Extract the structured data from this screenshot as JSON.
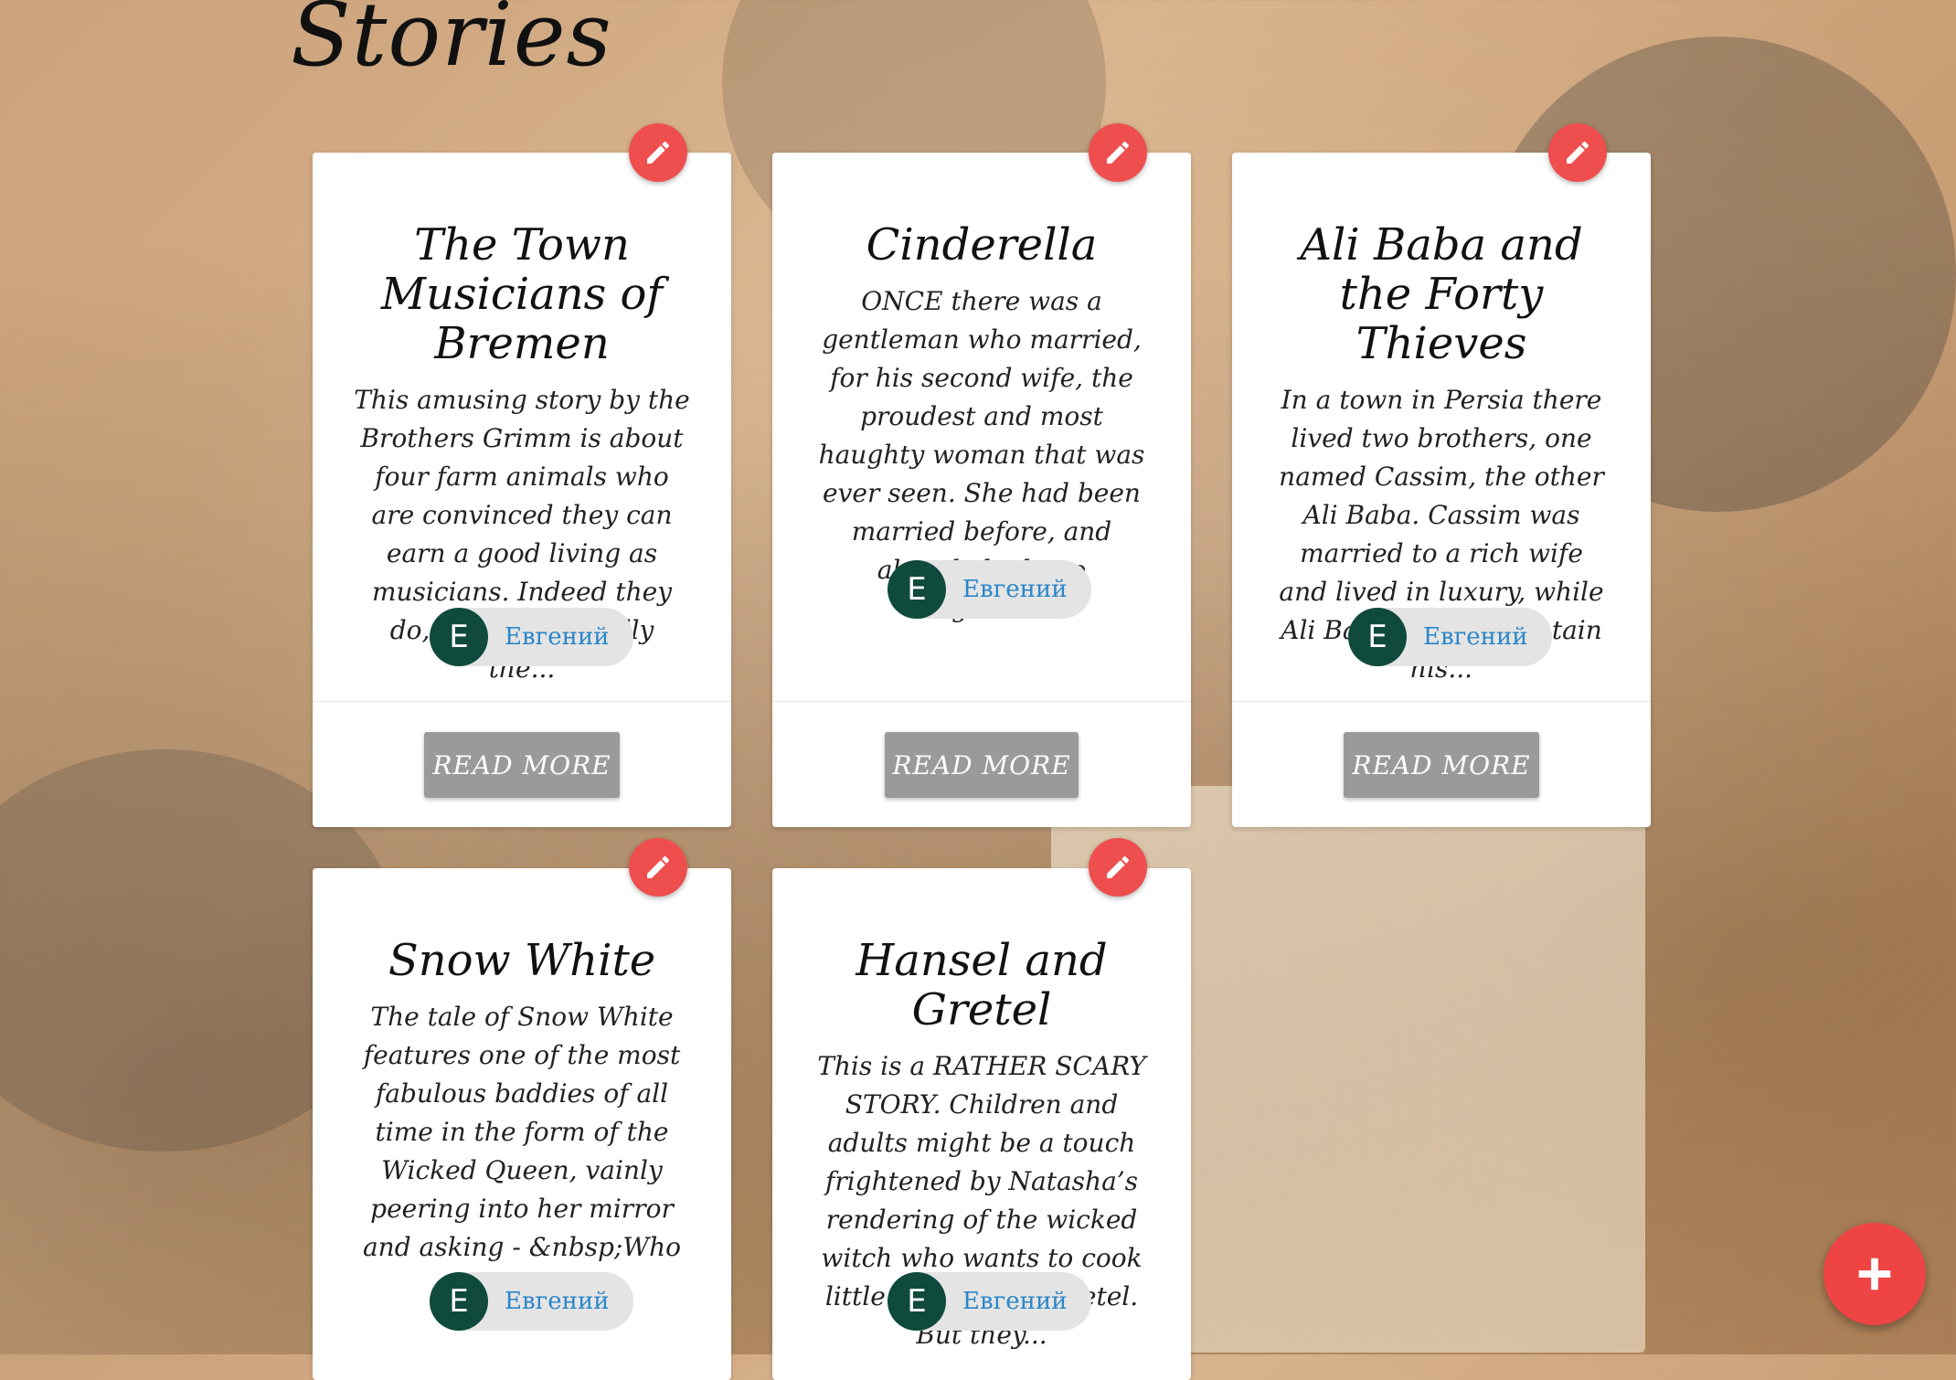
{
  "page": {
    "title": "Stories"
  },
  "stories": [
    {
      "title": "The Town Musicians of Bremen",
      "excerpt": "This amusing story by the Brothers Grimm is about four farm animals who are convinced they can earn a good living as musicians. Indeed they do, but it isn’t really the...",
      "author": {
        "initial": "E",
        "name": "Евгений"
      },
      "read_more_label": "READ MORE",
      "edit_icon": "pencil-icon"
    },
    {
      "title": "Cinderella",
      "excerpt": "ONCE there was a gentleman who married, for his second wife, the proudest and most haughty woman that was ever seen. She had been married before, and already had two daughters...",
      "author": {
        "initial": "E",
        "name": "Евгений"
      },
      "read_more_label": "READ MORE",
      "edit_icon": "pencil-icon"
    },
    {
      "title": "Ali Baba and the Forty Thieves",
      "excerpt": "In a town in Persia there lived two brothers, one named Cassim, the other Ali Baba. Cassim was married to a rich wife and lived in luxury, while Ali Baba had to maintain his...",
      "author": {
        "initial": "E",
        "name": "Евгений"
      },
      "read_more_label": "READ MORE",
      "edit_icon": "pencil-icon"
    },
    {
      "title": "Snow White",
      "excerpt": "The tale of Snow White features one of the most fabulous baddies of all time in the form of the Wicked Queen, vainly peering into her mirror and asking - &nbsp;Who is the...",
      "author": {
        "initial": "E",
        "name": "Евгений"
      },
      "read_more_label": "READ MORE",
      "edit_icon": "pencil-icon"
    },
    {
      "title": "Hansel and Gretel",
      "excerpt": "This is a RATHER SCARY STORY. Children and adults might be a touch frightened by Natasha’s rendering of the wicked witch who wants to cook little Hansel and Gretel. But they...",
      "author": {
        "initial": "E",
        "name": "Евгений"
      },
      "read_more_label": "READ MORE",
      "edit_icon": "pencil-icon"
    }
  ],
  "add_button": {
    "icon": "plus-icon"
  },
  "colors": {
    "accent_red": "#ef4e4e",
    "avatar_green": "#0f4a3c",
    "author_link_blue": "#2a86c9",
    "read_more_gray": "#9a9a9a"
  }
}
